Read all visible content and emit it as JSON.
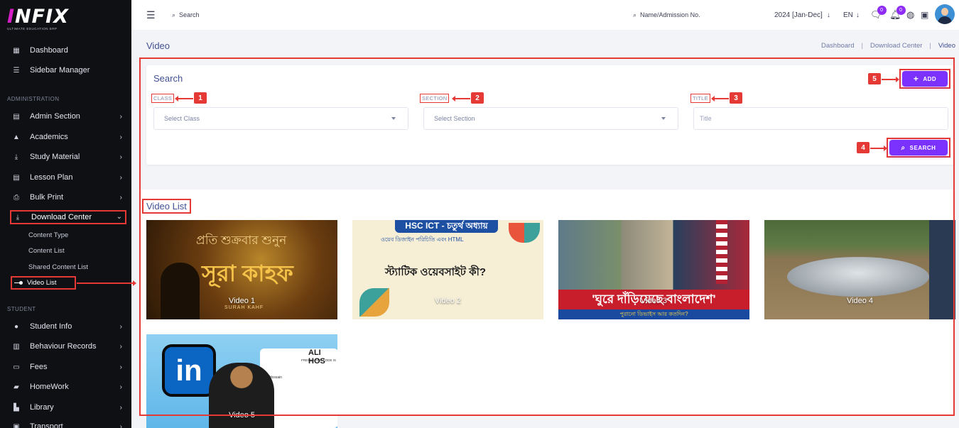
{
  "brand": {
    "logo_main": "INFIX",
    "logo_accent": "I",
    "logo_rest": "NFIX",
    "tagline": "ULTIMATE EDUCATION ERP"
  },
  "sidebar": {
    "items_top": [
      {
        "label": "Dashboard",
        "icon": "grid-icon"
      },
      {
        "label": "Sidebar Manager",
        "icon": "bars-icon"
      }
    ],
    "section_admin": "ADMINISTRATION",
    "items_admin": [
      {
        "label": "Admin Section",
        "icon": "book-icon"
      },
      {
        "label": "Academics",
        "icon": "graduation-icon"
      },
      {
        "label": "Study Material",
        "icon": "download-icon"
      },
      {
        "label": "Lesson Plan",
        "icon": "list-icon"
      },
      {
        "label": "Bulk Print",
        "icon": "printer-icon"
      },
      {
        "label": "Download Center",
        "icon": "download-icon"
      }
    ],
    "sub_items": [
      "Content Type",
      "Content List",
      "Shared Content List",
      "Video List"
    ],
    "section_student": "STUDENT",
    "items_student": [
      {
        "label": "Student Info",
        "icon": "user-icon"
      },
      {
        "label": "Behaviour Records",
        "icon": "records-icon"
      },
      {
        "label": "Fees",
        "icon": "money-icon"
      },
      {
        "label": "HomeWork",
        "icon": "book-open-icon"
      },
      {
        "label": "Library",
        "icon": "library-icon"
      },
      {
        "label": "Transport",
        "icon": "bus-icon"
      }
    ]
  },
  "topbar": {
    "search_placeholder": "Search",
    "student_search": "Name/Admission No.",
    "session": "2024 [Jan-Dec]",
    "language": "EN",
    "messages_count": "0",
    "notifications_count": "0"
  },
  "page": {
    "title": "Video",
    "breadcrumb": [
      "Dashboard",
      "Download Center",
      "Video"
    ]
  },
  "search_card": {
    "title": "Search",
    "class_label": "CLASS",
    "class_placeholder": "Select Class",
    "section_label": "SECTION",
    "section_placeholder": "Select Section",
    "title_label": "TITLE",
    "title_placeholder": "Title",
    "add_label": "ADD",
    "search_label": "SEARCH"
  },
  "callouts": [
    "1",
    "2",
    "3",
    "4",
    "5"
  ],
  "video_list": {
    "title": "Video List",
    "videos": [
      {
        "caption": "Video 1",
        "art": [
          "প্রতি শুক্রবার শুনুন",
          "সূরা কাহফ",
          "SURAH KAHF"
        ]
      },
      {
        "caption": "Video 2",
        "art": [
          "HSC ICT - চতুর্থ অধ্যায়",
          "ওয়েব ডিজাইন পরিচিতি এবং HTML",
          "স্ট্যাটিক ওয়েবসাইট কী?"
        ]
      },
      {
        "caption": "Video 3",
        "art": [
          "'ঘুরে দাঁড়িয়েছে বাংলাদেশ'",
          "পুরানো ডিভাইস আর কতদিন?"
        ]
      },
      {
        "caption": "Video 4",
        "art": []
      },
      {
        "caption": "Video 5",
        "art": [
          "ALI HOS",
          "FRESH HAND CODE IS",
          "Ali Hossain"
        ]
      }
    ]
  },
  "colors": {
    "accent": "#7c32ff",
    "sidebar_bg": "#0f1014",
    "annotation": "#e53935",
    "text": "#415094"
  }
}
